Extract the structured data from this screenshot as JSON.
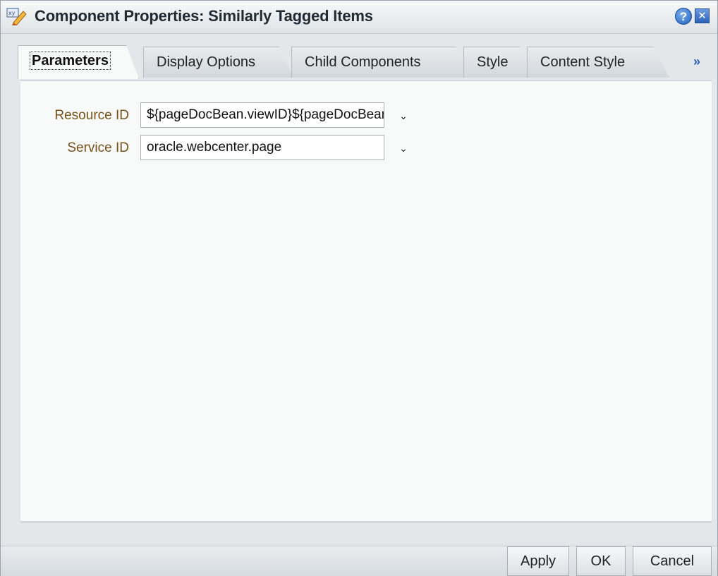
{
  "window": {
    "title": "Component Properties: Similarly Tagged Items",
    "title_icon": "edit-properties-icon",
    "help_label": "?",
    "close_label": "✕"
  },
  "tabs": [
    {
      "label": "Parameters",
      "active": true
    },
    {
      "label": "Display Options",
      "active": false
    },
    {
      "label": "Child Components",
      "active": false
    },
    {
      "label": "Style",
      "active": false
    },
    {
      "label": "Content Style",
      "active": false
    }
  ],
  "tab_overflow_label": "»",
  "fields": [
    {
      "label": "Resource ID",
      "value": "${pageDocBean.viewID}${pageDocBean.viewID}"
    },
    {
      "label": "Service ID",
      "value": "oracle.webcenter.page"
    }
  ],
  "dropdown_glyph": "⌄",
  "buttons": {
    "apply": "Apply",
    "ok": "OK",
    "cancel": "Cancel"
  },
  "colors": {
    "label": "#7a4f17",
    "accent": "#2a60b8"
  }
}
